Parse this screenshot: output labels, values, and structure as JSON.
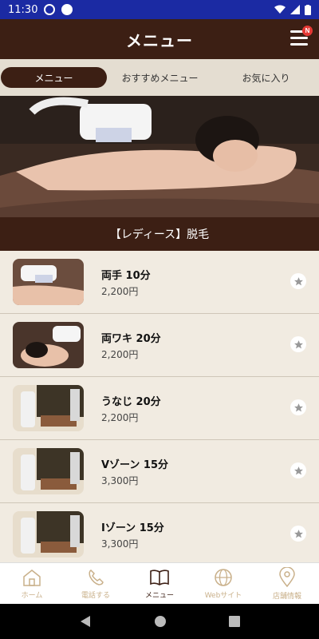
{
  "status_bar": {
    "time": "11:30"
  },
  "header": {
    "title": "メニュー",
    "notification_badge": "N"
  },
  "tabs": [
    {
      "label": "メニュー",
      "active": true
    },
    {
      "label": "おすすめメニュー",
      "active": false
    },
    {
      "label": "お気に入り",
      "active": false
    }
  ],
  "section": {
    "title": "【レディース】脱毛"
  },
  "items": [
    {
      "name": "両手 10分",
      "price": "2,200円"
    },
    {
      "name": "両ワキ 20分",
      "price": "2,200円"
    },
    {
      "name": "うなじ 20分",
      "price": "2,200円"
    },
    {
      "name": "Vゾーン 15分",
      "price": "3,300円"
    },
    {
      "name": "Iゾーン 15分",
      "price": "3,300円"
    }
  ],
  "bottom_nav": [
    {
      "label": "ホーム",
      "icon": "home-icon",
      "active": false
    },
    {
      "label": "電話する",
      "icon": "phone-icon",
      "active": false
    },
    {
      "label": "メニュー",
      "icon": "book-icon",
      "active": true
    },
    {
      "label": "Webサイト",
      "icon": "globe-icon",
      "active": false
    },
    {
      "label": "店舗情報",
      "icon": "map-pin-icon",
      "active": false
    }
  ],
  "colors": {
    "header": "#3c1f14",
    "status_bar": "#1b2aa3",
    "background": "#f1ebe1",
    "accent": "#c9b08a"
  }
}
